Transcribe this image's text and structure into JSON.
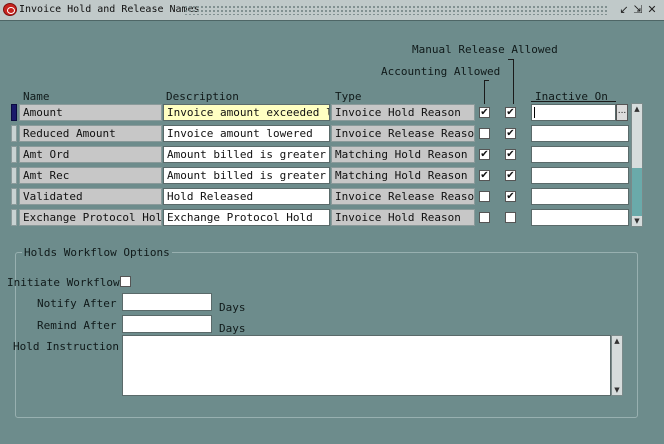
{
  "window": {
    "title": "Invoice Hold and Release Names",
    "controls": [
      "↙",
      "⇲",
      "✕"
    ]
  },
  "table": {
    "headers": {
      "name": "Name",
      "description": "Description",
      "type": "Type",
      "accounting_allowed": "Accounting Allowed",
      "manual_release_allowed": "Manual Release Allowed",
      "inactive_on": "Inactive On"
    },
    "rows": [
      {
        "name": "Amount",
        "description": "Invoice amount exceeded lim",
        "type": "Invoice Hold Reason",
        "accounting": true,
        "manual_release": true,
        "inactive_on": "",
        "current": true
      },
      {
        "name": "Reduced Amount",
        "description": "Invoice amount lowered",
        "type": "Invoice Release Reason",
        "accounting": false,
        "manual_release": true,
        "inactive_on": "",
        "current": false
      },
      {
        "name": "Amt Ord",
        "description": "Amount billed is greater th",
        "type": "Matching Hold Reason",
        "accounting": true,
        "manual_release": true,
        "inactive_on": "",
        "current": false
      },
      {
        "name": "Amt Rec",
        "description": "Amount billed is greater th",
        "type": "Matching Hold Reason",
        "accounting": true,
        "manual_release": true,
        "inactive_on": "",
        "current": false
      },
      {
        "name": "Validated",
        "description": "Hold Released",
        "type": "Invoice Release Reason",
        "accounting": false,
        "manual_release": true,
        "inactive_on": "",
        "current": false
      },
      {
        "name": "Exchange Protocol Hold",
        "description": "Exchange Protocol Hold",
        "type": "Invoice Hold Reason",
        "accounting": false,
        "manual_release": false,
        "inactive_on": "",
        "current": false
      }
    ],
    "lov_button": "..."
  },
  "workflow": {
    "title": "Holds Workflow Options",
    "initiate_label": "Initiate Workflow",
    "initiate_checked": false,
    "notify_label": "Notify After",
    "notify_value": "",
    "notify_unit": "Days",
    "remind_label": "Remind After",
    "remind_value": "",
    "remind_unit": "Days",
    "instruction_label": "Hold Instruction",
    "instruction_value": ""
  }
}
